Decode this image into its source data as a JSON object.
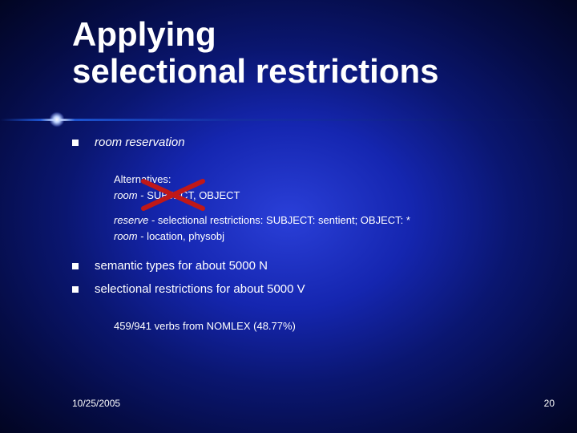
{
  "title": "Applying\nselectional restrictions",
  "bullets": {
    "b1": "room reservation",
    "b2": "semantic types for about 5000 N",
    "b3": "selectional restrictions for about 5000 V"
  },
  "sub": {
    "alt_label": "Alternatives:",
    "room_word": "room",
    "room_roles_dash": " - ",
    "room_roles": "SUBJECT, OBJECT",
    "reserve_word": "reserve",
    "reserve_rest": " -  selectional restrictions: SUBJECT: sentient; OBJECT: *",
    "room2_word": "room",
    "room2_rest": " - location, physobj",
    "nomlex": "459/941 verbs from NOMLEX (48.77%)"
  },
  "footer": {
    "date": "10/25/2005",
    "pagenum": "20"
  }
}
